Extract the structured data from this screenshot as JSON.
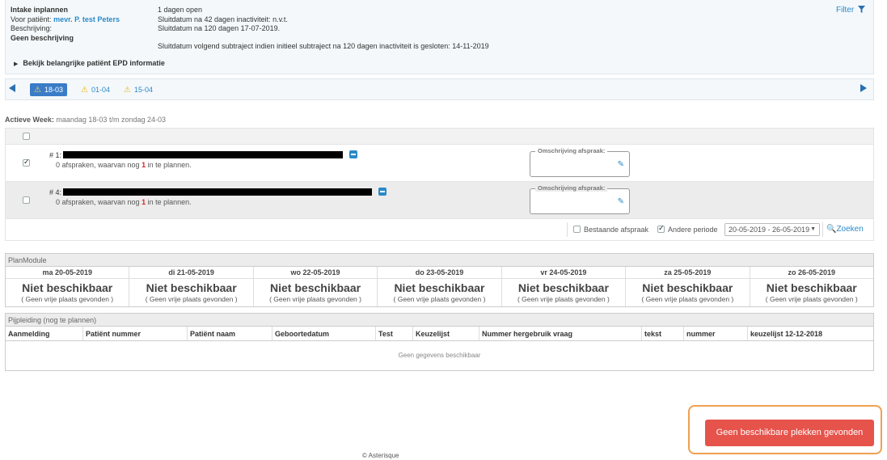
{
  "header": {
    "title": "Intake inplannen",
    "patient_label": "Voor patiënt:",
    "patient_name": "mevr. P. test Peters",
    "description_label": "Beschrijving:",
    "description_value": "Geen beschrijving",
    "days_open": "1 dagen open",
    "closing_42": "Sluitdatum na 42 dagen inactiviteit: n.v.t.",
    "closing_120": "Sluitdatum na 120 dagen 17-07-2019.",
    "closing_next": "Sluitdatum volgend subtraject indien initieel subtraject na 120 dagen inactiviteit is gesloten: 14-11-2019",
    "epd_link": "Bekijk belangrijke patiënt EPD informatie",
    "filter_label": "Filter"
  },
  "weeknav": {
    "tabs": [
      {
        "label": "18-03",
        "active": true
      },
      {
        "label": "01-04",
        "active": false
      },
      {
        "label": "15-04",
        "active": false
      }
    ]
  },
  "active_week": {
    "label": "Actieve Week:",
    "value": "maandag 18-03 t/m zondag 24-03"
  },
  "items": [
    {
      "prefix": "# 1:",
      "checked": true,
      "sub_pre": "0 afspraken, waarvan nog ",
      "sub_count": "1",
      "sub_post": " in te plannen.",
      "omschrijving_label": "Omschrijving afspraak:"
    },
    {
      "prefix": "# 4:",
      "checked": false,
      "sub_pre": "0 afspraken, waarvan nog ",
      "sub_count": "1",
      "sub_post": " in te plannen.",
      "omschrijving_label": "Omschrijving afspraak:"
    }
  ],
  "filterbar": {
    "bestaande": "Bestaande afspraak",
    "andere": "Andere periode",
    "period": "20-05-2019 - 26-05-2019",
    "search": "Zoeken"
  },
  "planmodule": {
    "title": "PlanModule",
    "days": [
      {
        "label": "ma 20-05-2019",
        "status": "Niet beschikbaar",
        "note": "( Geen vrije plaats gevonden )"
      },
      {
        "label": "di 21-05-2019",
        "status": "Niet beschikbaar",
        "note": "( Geen vrije plaats gevonden )"
      },
      {
        "label": "wo 22-05-2019",
        "status": "Niet beschikbaar",
        "note": "( Geen vrije plaats gevonden )"
      },
      {
        "label": "do 23-05-2019",
        "status": "Niet beschikbaar",
        "note": "( Geen vrije plaats gevonden )"
      },
      {
        "label": "vr 24-05-2019",
        "status": "Niet beschikbaar",
        "note": "( Geen vrije plaats gevonden )"
      },
      {
        "label": "za 25-05-2019",
        "status": "Niet beschikbaar",
        "note": "( Geen vrije plaats gevonden )"
      },
      {
        "label": "zo 26-05-2019",
        "status": "Niet beschikbaar",
        "note": "( Geen vrije plaats gevonden )"
      }
    ]
  },
  "pijplijn": {
    "title": "Pijpleiding (nog te plannen)",
    "columns": [
      "Aanmelding",
      "Patiënt nummer",
      "Patiënt naam",
      "Geboortedatum",
      "Test",
      "Keuzelijst",
      "Nummer hergebruik vraag",
      "tekst",
      "nummer",
      "keuzelijst 12-12-2018"
    ],
    "empty": "Geen gegevens beschikbaar"
  },
  "footer": "© Asterisque",
  "toast": "Geen beschikbare plekken gevonden"
}
